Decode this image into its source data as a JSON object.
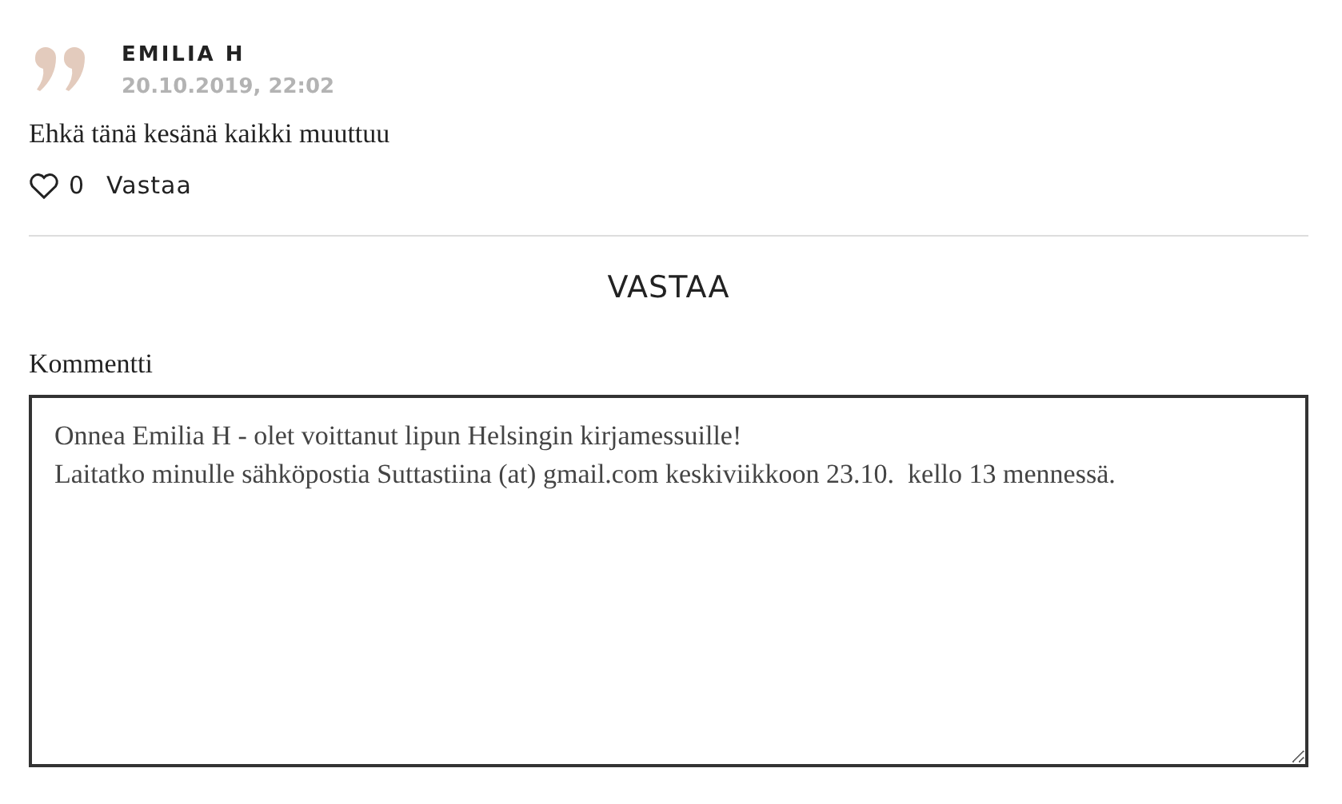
{
  "comment": {
    "author": "EMILIA H",
    "date": "20.10.2019, 22:02",
    "text": "Ehkä tänä kesänä kaikki muuttuu",
    "likes": "0",
    "reply_link": "Vastaa"
  },
  "reply_form": {
    "title": "VASTAA",
    "label": "Kommentti",
    "value": "Onnea Emilia H - olet voittanut lipun Helsingin kirjamessuille!\nLaitatko minulle sähköpostia Suttastiina (at) gmail.com keskiviikkoon 23.10.  kello 13 mennessä."
  }
}
